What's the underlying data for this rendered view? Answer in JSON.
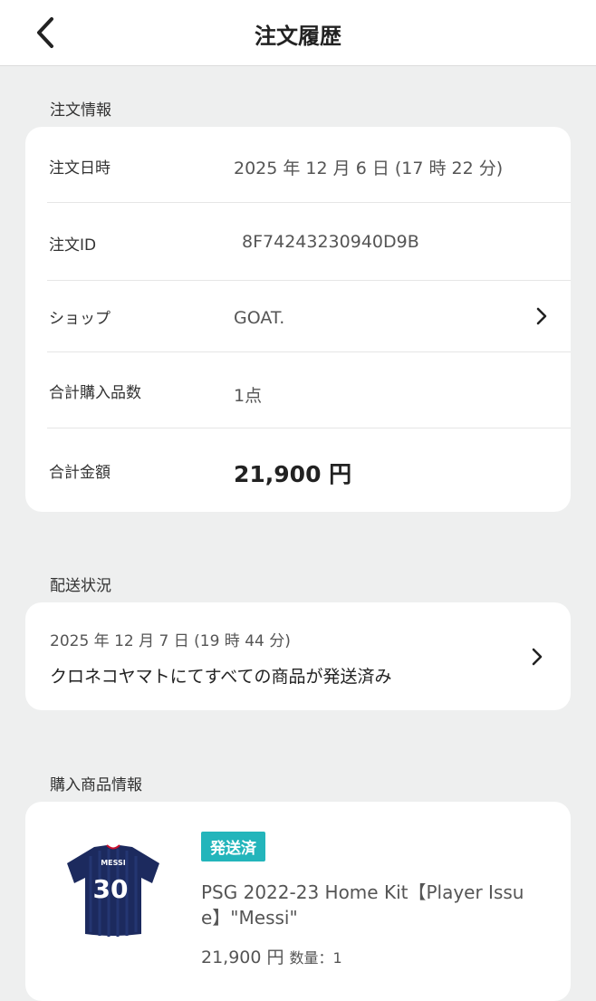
{
  "header": {
    "title": "注文履歴"
  },
  "order_info": {
    "section_title": "注文情報",
    "rows": [
      {
        "label": "注文日時",
        "value": "2025 年 12 月 6 日 (17 時 22 分)"
      },
      {
        "label": "注文ID",
        "value": "8F74243230940D9B"
      },
      {
        "label": "ショップ",
        "value": "GOAT."
      },
      {
        "label": "合計購入品数",
        "value": "1点"
      },
      {
        "label": "合計金額",
        "value": "21,900 円"
      }
    ]
  },
  "shipping": {
    "section_title": "配送状況",
    "date": "2025 年 12 月 7 日 (19 時 44 分)",
    "status": "クロネコヤマトにてすべての商品が発送済み"
  },
  "product_info": {
    "section_title": "購入商品情報",
    "badge": "発送済",
    "name": "PSG 2022-23 Home Kit【Player Issue】\"Messi\"",
    "price": "21,900 円",
    "quantity": "数量：1",
    "jersey_name": "MESSI",
    "jersey_number": "30"
  },
  "colors": {
    "badge": "#23b5bb",
    "background": "#eeefef",
    "jersey": "#1c2a5e"
  },
  "icons": [
    "back-chevron-icon",
    "chevron-right-icon"
  ]
}
